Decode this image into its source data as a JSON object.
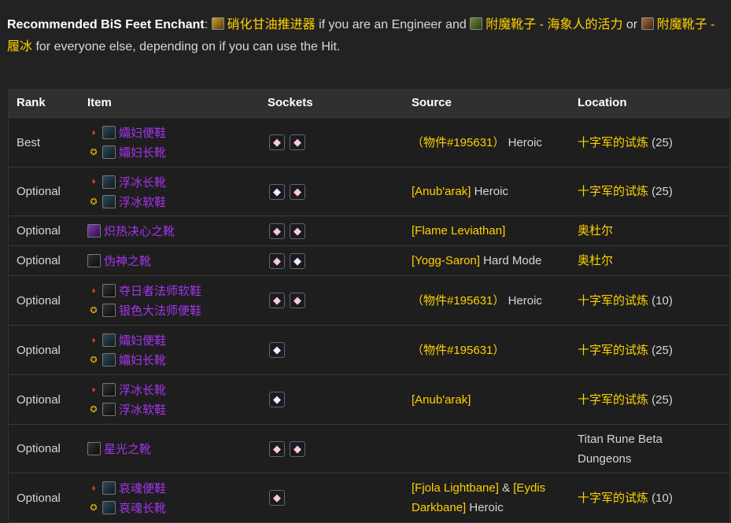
{
  "intro": {
    "label": "Recommended BiS Feet Enchant",
    "colon": ":",
    "ench1": "硝化甘油推进器",
    "text1": " if you are an Engineer and ",
    "ench2": "附魔靴子 - 海象人的活力",
    "text2": " or ",
    "ench3": "附魔靴子 - 履冰",
    "text3": " for everyone else, depending on if you can use the Hit."
  },
  "table": {
    "headers": [
      "Rank",
      "Item",
      "Sockets",
      "Source",
      "Location"
    ],
    "rows": [
      {
        "rank": "Best",
        "items": [
          {
            "f": "horde",
            "n": "孀妇便鞋"
          },
          {
            "f": "alliance",
            "n": "孀妇长靴"
          }
        ],
        "sockets": [
          "pink",
          "pink"
        ],
        "src": [
          {
            "t": "（物件#195631）",
            "c": "gold"
          },
          {
            "t": " Heroic",
            "c": "white"
          }
        ],
        "loc": [
          {
            "t": "十字军的试炼",
            "c": "gold"
          },
          {
            "t": " (25)",
            "c": "white"
          }
        ]
      },
      {
        "rank": "Optional",
        "items": [
          {
            "f": "horde",
            "n": "浮冰长靴"
          },
          {
            "f": "alliance",
            "n": "浮冰软鞋"
          }
        ],
        "sockets": [
          "white",
          "pink"
        ],
        "src": [
          {
            "t": "[Anub'arak]",
            "c": "gold"
          },
          {
            "t": " Heroic",
            "c": "white"
          }
        ],
        "loc": [
          {
            "t": "十字军的试炼",
            "c": "gold"
          },
          {
            "t": " (25)",
            "c": "white"
          }
        ]
      },
      {
        "rank": "Optional",
        "items": [
          {
            "f": "",
            "n": "炽热决心之靴"
          }
        ],
        "sockets": [
          "pink",
          "pink"
        ],
        "src": [
          {
            "t": "[Flame Leviathan]",
            "c": "gold"
          }
        ],
        "loc": [
          {
            "t": "奥杜尔",
            "c": "gold"
          }
        ]
      },
      {
        "rank": "Optional",
        "items": [
          {
            "f": "",
            "n": "伪神之靴"
          }
        ],
        "sockets": [
          "pink",
          "white"
        ],
        "src": [
          {
            "t": "[Yogg-Saron]",
            "c": "gold"
          },
          {
            "t": " Hard Mode",
            "c": "white"
          }
        ],
        "loc": [
          {
            "t": "奥杜尔",
            "c": "gold"
          }
        ]
      },
      {
        "rank": "Optional",
        "items": [
          {
            "f": "horde",
            "n": "夺日者法师软鞋"
          },
          {
            "f": "alliance",
            "n": "银色大法师便鞋"
          }
        ],
        "sockets": [
          "pink",
          "pink"
        ],
        "src": [
          {
            "t": "（物件#195631）",
            "c": "gold"
          },
          {
            "t": " Heroic",
            "c": "white"
          }
        ],
        "loc": [
          {
            "t": "十字军的试炼",
            "c": "gold"
          },
          {
            "t": " (10)",
            "c": "white"
          }
        ]
      },
      {
        "rank": "Optional",
        "items": [
          {
            "f": "horde",
            "n": "孀妇便鞋"
          },
          {
            "f": "alliance",
            "n": "孀妇长靴"
          }
        ],
        "sockets": [
          "white"
        ],
        "src": [
          {
            "t": "（物件#195631）",
            "c": "gold"
          }
        ],
        "loc": [
          {
            "t": "十字军的试炼",
            "c": "gold"
          },
          {
            "t": " (25)",
            "c": "white"
          }
        ]
      },
      {
        "rank": "Optional",
        "items": [
          {
            "f": "horde",
            "n": "浮冰长靴"
          },
          {
            "f": "alliance",
            "n": "浮冰软鞋"
          }
        ],
        "sockets": [
          "white"
        ],
        "src": [
          {
            "t": "[Anub'arak]",
            "c": "gold"
          }
        ],
        "loc": [
          {
            "t": "十字军的试炼",
            "c": "gold"
          },
          {
            "t": " (25)",
            "c": "white"
          }
        ]
      },
      {
        "rank": "Optional",
        "items": [
          {
            "f": "",
            "n": "星光之靴"
          }
        ],
        "sockets": [
          "pink",
          "pink"
        ],
        "src": [],
        "loc": [
          {
            "t": "Titan Rune Beta Dungeons",
            "c": "white"
          }
        ]
      },
      {
        "rank": "Optional",
        "items": [
          {
            "f": "horde",
            "n": "哀魂便鞋"
          },
          {
            "f": "alliance",
            "n": "哀魂长靴"
          }
        ],
        "sockets": [
          "pink"
        ],
        "src": [
          {
            "t": "[Fjola Lightbane]",
            "c": "gold"
          },
          {
            "t": " & ",
            "c": "white"
          },
          {
            "t": "[Eydis Darkbane]",
            "c": "gold"
          },
          {
            "t": " Heroic",
            "c": "white"
          }
        ],
        "loc": [
          {
            "t": "十字军的试炼",
            "c": "gold"
          },
          {
            "t": " (10)",
            "c": "white"
          }
        ]
      }
    ]
  }
}
